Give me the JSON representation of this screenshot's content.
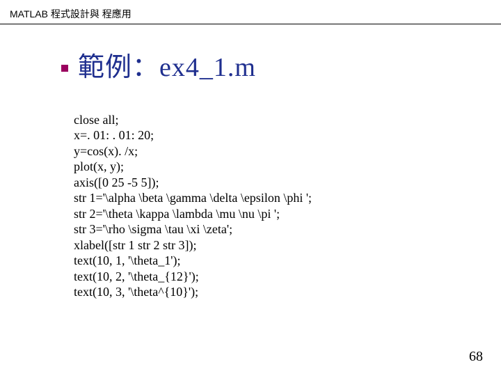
{
  "header": "MATLAB 程式設計與 程應用",
  "title": "範例：ex4_1.m",
  "code": [
    "close all;",
    "x=. 01: . 01: 20;",
    "y=cos(x). /x;",
    "plot(x, y);",
    "axis([0 25 -5 5]);",
    "str 1='\\alpha \\beta \\gamma \\delta \\epsilon \\phi ';",
    "str 2='\\theta \\kappa \\lambda \\mu \\nu \\pi ';",
    "str 3='\\rho \\sigma \\tau \\xi \\zeta';",
    "xlabel([str 1 str 2 str 3]);",
    "text(10, 1, '\\theta_1');",
    "text(10, 2, '\\theta_{12}');",
    "text(10, 3, '\\theta^{10}');"
  ],
  "page_number": "68"
}
